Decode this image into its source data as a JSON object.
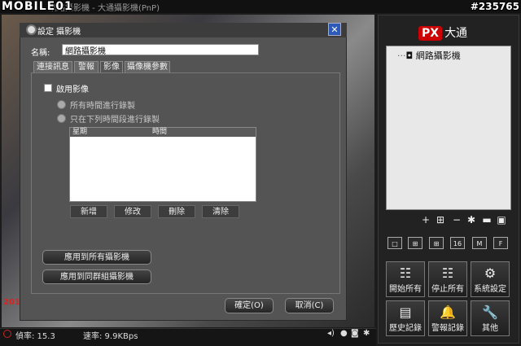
{
  "app": {
    "title": "網路攝影機 - 大通攝影機(PnP)",
    "watermark_logo": "MOBILE01",
    "watermark_id": "#235765",
    "video_stamp": "201"
  },
  "status": {
    "fps_label": "偵率: 15.3",
    "rate_label": "速率: 9.9KBps"
  },
  "brand": {
    "px": "PX",
    "name": "大通"
  },
  "tree": {
    "item": "網路攝影機"
  },
  "layouts": [
    "□",
    "⊞",
    "⊞",
    "16",
    "M",
    "F"
  ],
  "actions": [
    {
      "label": "開始所有",
      "icon": "☷"
    },
    {
      "label": "停止所有",
      "icon": "☷"
    },
    {
      "label": "系統設定",
      "icon": "⚙"
    },
    {
      "label": "歷史記錄",
      "icon": "▤"
    },
    {
      "label": "警報記錄",
      "icon": "🔔"
    },
    {
      "label": "其他",
      "icon": "🔧"
    }
  ],
  "dialog": {
    "title": "設定 攝影機",
    "close": "✕",
    "name_label": "名稱:",
    "name_value": "網路攝影機",
    "tabs": [
      "連接訊息",
      "警報",
      "影像",
      "攝像機參數"
    ],
    "active_tab": 2,
    "enable_video": "啟用影像",
    "radio_all": "所有時間進行錄製",
    "radio_period": "只在下列時間段進行錄製",
    "table_cols": [
      "星期",
      "時間"
    ],
    "buttons": {
      "add": "新增",
      "edit": "修改",
      "delete": "刪除",
      "clear": "清除"
    },
    "apply_all": "應用到所有攝影機",
    "apply_group": "應用到同群組攝影機",
    "ok": "確定(O)",
    "cancel": "取消(C)"
  },
  "colors": {
    "accent": "#2d5ab7",
    "brand_red": "#cc0000"
  }
}
